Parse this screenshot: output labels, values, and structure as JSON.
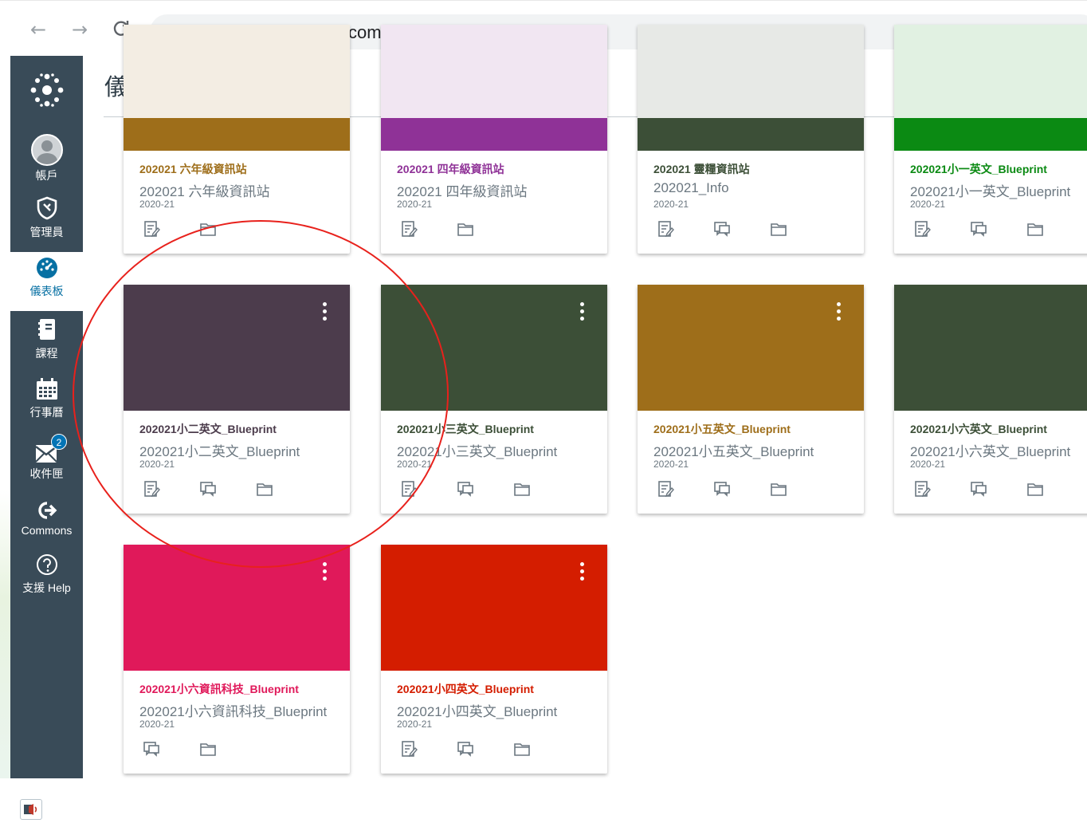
{
  "browser": {
    "url": "hkedcity.instructure.com",
    "back_icon": "←",
    "forward_icon": "→",
    "reload_icon": "C"
  },
  "global_nav": {
    "account": "帳戶",
    "admin": "管理員",
    "dashboard": "儀表板",
    "courses": "課程",
    "calendar": "行事曆",
    "inbox": "收件匣",
    "inbox_badge": "2",
    "commons": "Commons",
    "help": "支援 Help",
    "collapse_icon": "|←",
    "brand_color": "#394b58"
  },
  "header": {
    "title": "儀表板"
  },
  "cards": [
    {
      "title": "202021 六年級資訊站",
      "code": "202021 六年級資訊站",
      "term": "2020-21",
      "color": "#9e6e1a",
      "actions": [
        "announcements-icon",
        "files-icon"
      ]
    },
    {
      "title": "202021 四年級資訊站",
      "code": "202021 四年級資訊站",
      "term": "2020-21",
      "color": "#8f3297",
      "actions": [
        "announcements-icon",
        "files-icon"
      ]
    },
    {
      "title": "202021 靈糧資訊站",
      "code": "202021_Info",
      "term": "2020-21",
      "color": "#3c4f37",
      "actions": [
        "announcements-icon",
        "discussions-icon",
        "files-icon"
      ]
    },
    {
      "title": "202021小一英文_Blueprint",
      "code": "202021小一英文_Blueprint",
      "term": "2020-21",
      "color": "#0b8a13",
      "actions": [
        "announcements-icon",
        "discussions-icon",
        "files-icon"
      ]
    },
    {
      "title": "202021小二英文_Blueprint",
      "code": "202021小二英文_Blueprint",
      "term": "2020-21",
      "color": "#4c3c4c",
      "actions": [
        "announcements-icon",
        "discussions-icon",
        "files-icon"
      ]
    },
    {
      "title": "202021小三英文_Blueprint",
      "code": "202021小三英文_Blueprint",
      "term": "2020-21",
      "color": "#3c4f37",
      "actions": [
        "announcements-icon",
        "discussions-icon",
        "files-icon"
      ]
    },
    {
      "title": "202021小五英文_Blueprint",
      "code": "202021小五英文_Blueprint",
      "term": "2020-21",
      "color": "#9e6e1a",
      "actions": [
        "announcements-icon",
        "discussions-icon",
        "files-icon"
      ]
    },
    {
      "title": "202021小六英文_Blueprint",
      "code": "202021小六英文_Blueprint",
      "term": "2020-21",
      "color": "#3c4f37",
      "actions": [
        "announcements-icon",
        "discussions-icon",
        "files-icon"
      ]
    },
    {
      "title": "202021小六資訊科技_Blueprint",
      "code": "202021小六資訊科技_Blueprint",
      "term": "2020-21",
      "color": "#e0195a",
      "actions": [
        "discussions-icon",
        "files-icon"
      ]
    },
    {
      "title": "202021小四英文_Blueprint",
      "code": "202021小四英文_Blueprint",
      "term": "2020-21",
      "color": "#d41d00",
      "actions": [
        "announcements-icon",
        "discussions-icon",
        "files-icon"
      ]
    }
  ]
}
